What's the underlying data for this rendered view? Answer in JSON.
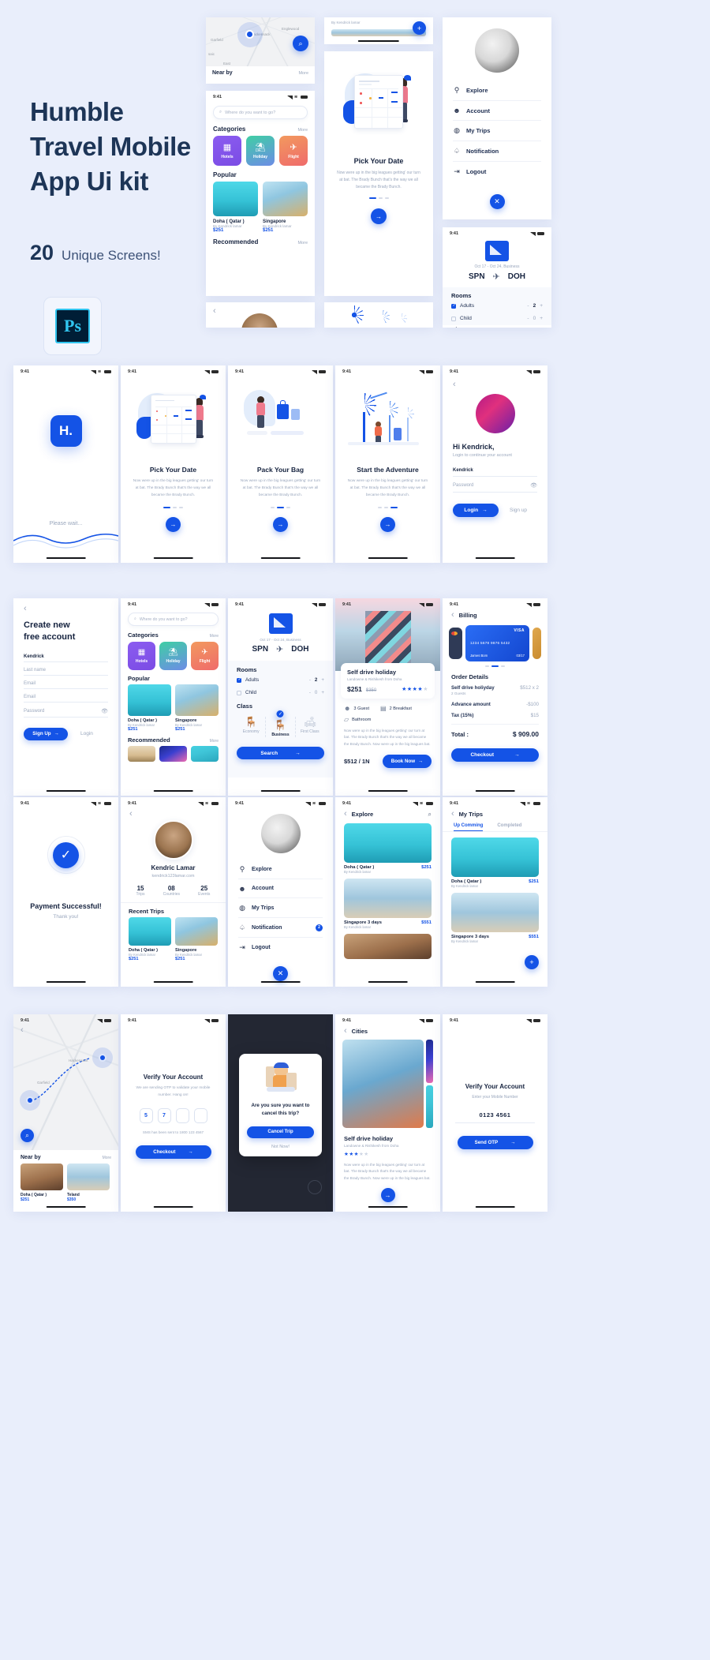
{
  "hero": {
    "title_line1": "Humble",
    "title_line2": "Travel Mobile",
    "title_line3": "App Ui kit",
    "count": "20",
    "count_label": "Unique Screens!",
    "software_badge": "Ps"
  },
  "common": {
    "status_time": "9:41",
    "brand_color": "#1453e6",
    "onboard_body": "Now were up in the big leagues getting' our turn at bat. The Brady Bunch that's the way we all became the Brady Bunch.",
    "more": "More",
    "arrow": "→",
    "back": "‹"
  },
  "nearby": {
    "title": "Near by",
    "more": "More",
    "map_labels": [
      "Garfield",
      "Hackensack",
      "Englewood",
      "saic",
      "East"
    ],
    "search_icon": "search-icon"
  },
  "home": {
    "search_placeholder": "Where do you want to go?",
    "categories_title": "Categories",
    "categories_more": "More",
    "categories": [
      {
        "label": "Hotels",
        "icon": "hotel-icon"
      },
      {
        "label": "Holiday",
        "icon": "palm-icon"
      },
      {
        "label": "Flight",
        "icon": "flight-icon"
      }
    ],
    "popular_title": "Popular",
    "popular": [
      {
        "name": "Doha ( Qatar )",
        "by": "By Kendrick lamar",
        "price": "$251"
      },
      {
        "name": "Singapore",
        "by": "By Kendrick lamar",
        "price": "$251"
      }
    ],
    "recommended_title": "Recommended",
    "recommended_more": "More"
  },
  "onboarding": [
    {
      "title": "Pick Your Date",
      "illustration": "calendar-illustration",
      "active_dot": 0
    },
    {
      "title": "Pack Your Bag",
      "illustration": "luggage-illustration",
      "active_dot": 1
    },
    {
      "title": "Start the Adventure",
      "illustration": "palm-illustration",
      "active_dot": 2
    }
  ],
  "splash": {
    "logo": "H.",
    "wait_text": "Please wait..."
  },
  "login": {
    "greeting": "Hi Kendrick,",
    "subtitle": "Login to continue your account",
    "username_value": "Kendrick",
    "password_placeholder": "Password",
    "login_button": "Login",
    "signup_link": "Sign up",
    "eye_icon": "eye-icon"
  },
  "signup": {
    "title_line1": "Create new",
    "title_line2": "free account",
    "first_name_value": "Kendrick",
    "last_name_placeholder": "Last name",
    "email_placeholder": "Email",
    "email2_placeholder": "Email",
    "password_placeholder": "Password",
    "signup_button": "Sign Up",
    "login_link": "Login"
  },
  "flight_search": {
    "date_line": "Oct 17 - Oct 24, Business",
    "from": "SPN",
    "to": "DOH",
    "plane_icon": "airplane-icon",
    "rooms_title": "Rooms",
    "rows": [
      {
        "label": "Adults",
        "checked": true,
        "minus": "-",
        "value": "2",
        "plus": "+"
      },
      {
        "label": "Child",
        "checked": false,
        "minus": "-",
        "value": "0",
        "plus": "+"
      }
    ],
    "class_title": "Class",
    "classes": [
      {
        "label": "Economy",
        "selected": false,
        "icon": "economy-seat-icon"
      },
      {
        "label": "Business",
        "selected": true,
        "icon": "business-seat-icon"
      },
      {
        "label": "First Class",
        "selected": false,
        "icon": "first-class-seat-icon"
      }
    ],
    "search_button": "Search"
  },
  "holiday_detail": {
    "title": "Self drive holiday",
    "subtitle": "Landowne & Rishikesh from Doha",
    "price": "$251",
    "price_old": "$350",
    "rating": 4,
    "rating_max": 5,
    "amenities": [
      {
        "label": "3 Guest",
        "icon": "guest-icon"
      },
      {
        "label": "2 Breakfast",
        "icon": "breakfast-icon"
      },
      {
        "label": "Bathroom",
        "icon": "bathtub-icon"
      }
    ],
    "description": "Now were up in the big leagues getting' our turn at bat. The Brady Bunch that's the way we all became the Brady Bunch. Now were up in the big leagues bat.",
    "rate": "$512 / 1N",
    "book_button": "Book Now"
  },
  "billing": {
    "header": "Billing",
    "cards": [
      {
        "brand": "VISA",
        "number": "1234  5678  9876  5432",
        "holder": "James Bom",
        "expiry": "03/17",
        "color": "#1453e6"
      }
    ],
    "order_title": "Order Details",
    "lines": [
      {
        "label": "Self drive holiyday",
        "sub": "2 Guests",
        "value": "$512 x 2"
      },
      {
        "label": "Advance amount",
        "sub": "",
        "value": "-$100"
      },
      {
        "label": "Tax (15%)",
        "sub": "",
        "value": "$15"
      }
    ],
    "total_label": "Total :",
    "total_value": "$ 909.00",
    "checkout_button": "Checkout"
  },
  "payment_success": {
    "title": "Payment Successful!",
    "subtitle": "Thank you!",
    "icon": "check-circle-icon"
  },
  "profile": {
    "name": "Kendric Lamar",
    "email": "kendrick123lamar.com",
    "stats": [
      {
        "value": "15",
        "label": "Trips"
      },
      {
        "value": "08",
        "label": "Countries"
      },
      {
        "value": "25",
        "label": "Events"
      }
    ],
    "recent_title": "Recent Trips",
    "recent": [
      {
        "name": "Doha ( Qatar )",
        "by": "By Kendrick lamar",
        "price": "$251"
      },
      {
        "name": "Singapore",
        "by": "By Kendrick lamar",
        "price": "$251"
      }
    ]
  },
  "menu": {
    "items": [
      {
        "label": "Explore",
        "icon": "explore-icon",
        "badge": ""
      },
      {
        "label": "Account",
        "icon": "user-icon",
        "badge": ""
      },
      {
        "label": "My Trips",
        "icon": "globe-icon",
        "badge": ""
      },
      {
        "label": "Notification",
        "icon": "bell-icon",
        "badge": "2"
      },
      {
        "label": "Logout",
        "icon": "logout-icon",
        "badge": ""
      }
    ],
    "close_icon": "close-icon"
  },
  "explore": {
    "header": "Explore",
    "search_icon": "search-icon",
    "items": [
      {
        "name": "Doha ( Qatar )",
        "by": "By Kendrick lamar",
        "price": "$251"
      },
      {
        "name": "Singapore 3 days",
        "by": "By Kendrick lamar",
        "price": "$551"
      },
      {
        "name": "",
        "by": "",
        "price": ""
      }
    ]
  },
  "my_trips": {
    "header": "My Trips",
    "tabs": [
      {
        "label": "Up Comming",
        "active": true
      },
      {
        "label": "Completed",
        "active": false
      }
    ],
    "items": [
      {
        "name": "Doha ( Qatar )",
        "by": "By Kendrick lamar",
        "price": "$251"
      },
      {
        "name": "Singapore 3 days",
        "by": "By Kendrick lamar",
        "price": "$551"
      }
    ],
    "add_icon": "plus-icon"
  },
  "map_nearby": {
    "title": "Near by",
    "more": "More",
    "cards": [
      {
        "name": "Doha ( Qatar )",
        "price": "$251"
      },
      {
        "name": "Teland",
        "price": "$350"
      }
    ]
  },
  "verify_otp": {
    "title": "Verify Your Account",
    "subtitle": "We are sending OTP to validate your mobile number. Hang on!",
    "digits": [
      "5",
      "7",
      "",
      ""
    ],
    "resend_text": "SMS has been sent to 1800 123 4567",
    "button": "Checkout"
  },
  "cancel_modal": {
    "question": "Are you sure you want to cancel this trip?",
    "confirm": "Cancel Trip",
    "dismiss": "Not Now!",
    "icon": "support-agent-icon"
  },
  "cities": {
    "header": "Cities",
    "title": "Self drive holiday",
    "subtitle": "Landowne & Rishikesh from Doha",
    "rating": 3,
    "rating_max": 5,
    "description": "Now were up in the big leagues getting' our turn at bat. The Brady Bunch that's the way we all became the Brady Bunch. Now were up in the big leagues bat."
  },
  "verify_mobile": {
    "title": "Verify Your Account",
    "subtitle": "Enter your Mobile Number",
    "value": "0123 4561",
    "button": "Send OTP"
  }
}
